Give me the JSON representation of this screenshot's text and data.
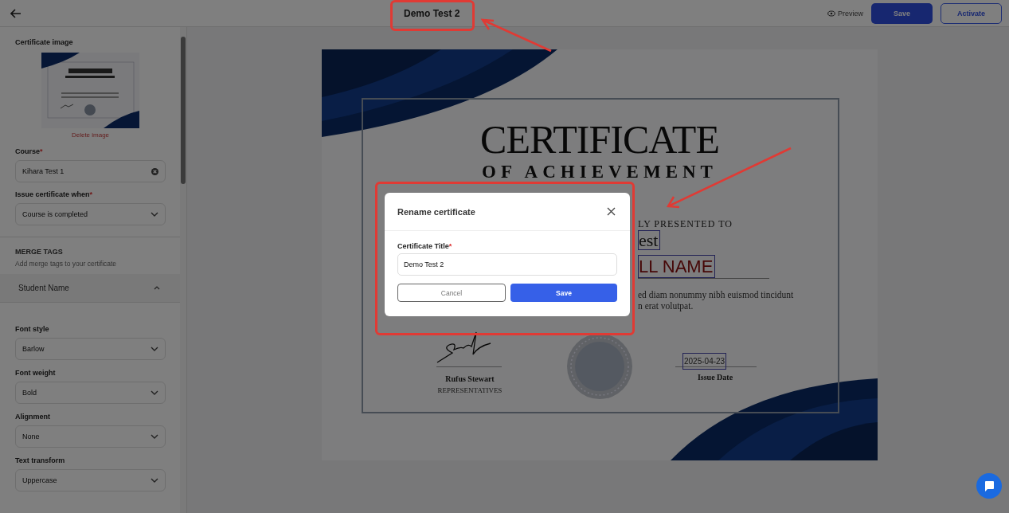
{
  "header": {
    "title": "Demo Test 2",
    "preview": "Preview",
    "save": "Save",
    "activate": "Activate"
  },
  "sidebar": {
    "image_label": "Certificate image",
    "delete_image": "Delete image",
    "fields": [
      {
        "label": "Course",
        "required_mark": "*",
        "value": "Kihara Test 1",
        "kind": "clearable"
      },
      {
        "label": "Issue certificate when",
        "required_mark": "*",
        "value": "Course is completed",
        "kind": "select"
      }
    ],
    "merge_tags": {
      "title": "MERGE TAGS",
      "subtitle": "Add merge tags to your certificate",
      "accordion": {
        "label": "Student Name",
        "expanded": true
      }
    },
    "style_fields": [
      {
        "label": "Font style",
        "value": "Barlow",
        "kind": "select"
      },
      {
        "label": "Font weight",
        "value": "Bold",
        "kind": "select"
      },
      {
        "label": "Alignment",
        "value": "None",
        "kind": "select"
      },
      {
        "label": "Text transform",
        "value": "Uppercase",
        "kind": "select"
      }
    ]
  },
  "certificate": {
    "title": "CERTIFICATE",
    "subtitle": "OF ACHIEVEMENT",
    "presented": "LY PRESENTED TO",
    "name_fragment": "est",
    "full_name": "LL NAME",
    "body": [
      "ed diam nonummy nibh euismod tincidunt",
      "n erat volutpat."
    ],
    "signer": "Rufus Stewart",
    "signer_role": "REPRESENTATIVES",
    "date": "2025-04-23",
    "date_label": "Issue Date"
  },
  "modal": {
    "title": "Rename certificate",
    "field": {
      "label": "Certificate Title",
      "required_mark": "*",
      "value": "Demo Test 2"
    },
    "cancel": "Cancel",
    "save": "Save"
  }
}
